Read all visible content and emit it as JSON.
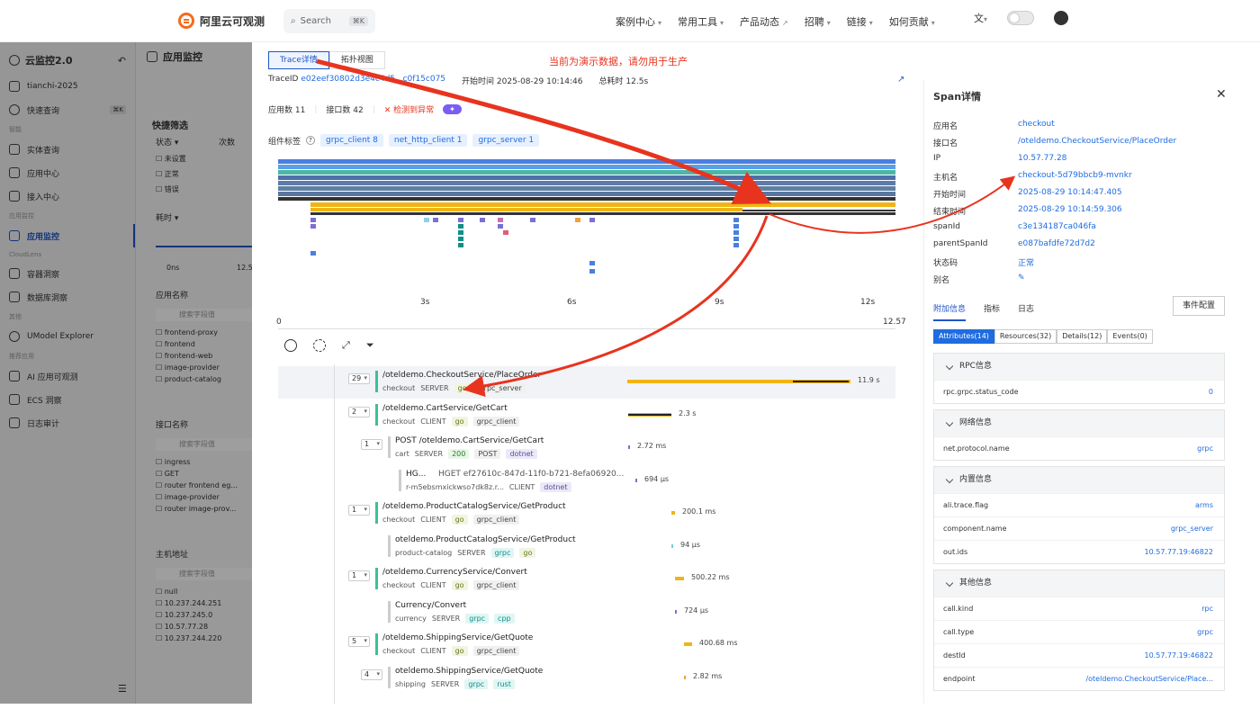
{
  "top": {
    "logo_text": "阿里云可观测",
    "search_placeholder": "Search",
    "search_kbd": "⌘K",
    "nav": [
      "案例中心",
      "常用工具",
      "产品动态",
      "招聘",
      "链接",
      "如何贡献"
    ]
  },
  "sidebar": {
    "title": "云监控2.0",
    "workspace": "tianchi-2025",
    "quick": "快速查询",
    "quick_kbd": "⌘K",
    "group1": "智能",
    "items1": [
      "实体查询",
      "应用中心",
      "接入中心"
    ],
    "group2": "应用监控",
    "active": "应用监控",
    "group3": "CloudLens",
    "items3": [
      "容器洞察",
      "数据库洞察"
    ],
    "group4": "其他",
    "items4": [
      "UModel Explorer"
    ],
    "group5": "推荐应用",
    "items5": [
      "AI 应用可观测",
      "ECS 洞察",
      "日志审计"
    ]
  },
  "filter": {
    "header": "应用监控",
    "quick_filter": "快捷筛选",
    "status": "状态",
    "count": "次数",
    "statuses": [
      "未设置",
      "正常",
      "错误"
    ],
    "elapsed": "耗时",
    "elapsed_min": "0ns",
    "elapsed_max": "12.5",
    "app_name": "应用名称",
    "search_field": "搜索字段值",
    "apps": [
      "frontend-proxy",
      "frontend",
      "frontend-web",
      "image-provider",
      "product-catalog"
    ],
    "iface": "接口名称",
    "ifaces": [
      "ingress",
      "GET",
      "router frontend eg...",
      "image-provider",
      "router image-prov..."
    ],
    "host": "主机地址",
    "hosts": [
      "null",
      "10.237.244.251",
      "10.237.245.0",
      "10.57.77.28",
      "10.237.244.220"
    ]
  },
  "trace": {
    "tab_detail": "Trace详情",
    "tab_topo": "拓扑视图",
    "warning": "当前为演示数据，请勿用于生产",
    "traceid_label": "TraceID",
    "traceid": "e02eef30802d3e4c4d5...c0f15c075",
    "start_label": "开始时间",
    "start": "2025-08-29 10:14:46",
    "total_label": "总耗时",
    "total": "12.5s",
    "apps_count": "应用数 11",
    "iface_count": "接口数 42",
    "anomaly": "检测到异常",
    "comp_label": "组件标签",
    "comp_tags": [
      "grpc_client 8",
      "net_http_client 1",
      "grpc_server 1"
    ],
    "axis": [
      "0",
      "3s",
      "6s",
      "9s",
      "12s",
      "12.57"
    ]
  },
  "spans": [
    {
      "count": "29",
      "name": "/oteldemo.CheckoutService/PlaceOrder",
      "svc": "checkout",
      "kind": "SERVER",
      "tags": [
        "go",
        "grpc_server"
      ],
      "dur": "11.9 s"
    },
    {
      "count": "2",
      "name": "/oteldemo.CartService/GetCart",
      "svc": "checkout",
      "kind": "CLIENT",
      "tags": [
        "go",
        "grpc_client"
      ],
      "dur": "2.3 s"
    },
    {
      "count": "1",
      "name": "POST /oteldemo.CartService/GetCart",
      "svc": "cart",
      "kind": "SERVER",
      "tags": [
        "200",
        "POST",
        "dotnet"
      ],
      "dur": "2.72 ms"
    },
    {
      "count": "",
      "name": "HG...",
      "extra": "HGET ef27610c-847d-11f0-b721-8efa06920...",
      "svc": "r-m5ebsmxickwso7dk8z.r...",
      "kind": "CLIENT",
      "tags": [
        "dotnet"
      ],
      "dur": "694 µs"
    },
    {
      "count": "1",
      "name": "/oteldemo.ProductCatalogService/GetProduct",
      "svc": "checkout",
      "kind": "CLIENT",
      "tags": [
        "go",
        "grpc_client"
      ],
      "dur": "200.1 ms"
    },
    {
      "count": "",
      "name": "oteldemo.ProductCatalogService/GetProduct",
      "svc": "product-catalog",
      "kind": "SERVER",
      "tags": [
        "grpc",
        "go"
      ],
      "dur": "94 µs"
    },
    {
      "count": "1",
      "name": "/oteldemo.CurrencyService/Convert",
      "svc": "checkout",
      "kind": "CLIENT",
      "tags": [
        "go",
        "grpc_client"
      ],
      "dur": "500.22 ms"
    },
    {
      "count": "",
      "name": "Currency/Convert",
      "svc": "currency",
      "kind": "SERVER",
      "tags": [
        "grpc",
        "cpp"
      ],
      "dur": "724 µs"
    },
    {
      "count": "5",
      "name": "/oteldemo.ShippingService/GetQuote",
      "svc": "checkout",
      "kind": "CLIENT",
      "tags": [
        "go",
        "grpc_client"
      ],
      "dur": "400.68 ms"
    },
    {
      "count": "4",
      "name": "oteldemo.ShippingService/GetQuote",
      "svc": "shipping",
      "kind": "SERVER",
      "tags": [
        "grpc",
        "rust"
      ],
      "dur": "2.82 ms"
    }
  ],
  "span_detail": {
    "title": "Span详情",
    "fields": [
      {
        "k": "应用名",
        "v": "checkout"
      },
      {
        "k": "接口名",
        "v": "/oteldemo.CheckoutService/PlaceOrder"
      },
      {
        "k": "IP",
        "v": "10.57.77.28"
      },
      {
        "k": "主机名",
        "v": "checkout-5d79bbcb9-mvnkr"
      },
      {
        "k": "开始时间",
        "v": "2025-08-29 10:14:47.405"
      },
      {
        "k": "结束时间",
        "v": "2025-08-29 10:14:59.306"
      },
      {
        "k": "spanId",
        "v": "c3e134187ca046fa"
      },
      {
        "k": "parentSpanId",
        "v": "e087bafdfe72d7d2"
      },
      {
        "k": "状态码",
        "v": "正常"
      },
      {
        "k": "别名",
        "v": "✎"
      }
    ],
    "tabs": [
      "附加信息",
      "指标",
      "日志"
    ],
    "event_btn": "事件配置",
    "attr_tabs": [
      "Attributes(14)",
      "Resources(32)",
      "Details(12)",
      "Events(0)"
    ],
    "cards": [
      {
        "title": "RPC信息",
        "rows": [
          {
            "k": "rpc.grpc.status_code",
            "v": "0"
          }
        ]
      },
      {
        "title": "网络信息",
        "rows": [
          {
            "k": "net.protocol.name",
            "v": "grpc"
          }
        ]
      },
      {
        "title": "内置信息",
        "rows": [
          {
            "k": "ali.trace.flag",
            "v": "arms"
          },
          {
            "k": "component.name",
            "v": "grpc_server"
          },
          {
            "k": "out.ids",
            "v": "10.57.77.19:46822"
          }
        ]
      },
      {
        "title": "其他信息",
        "rows": [
          {
            "k": "call.kind",
            "v": "rpc"
          },
          {
            "k": "call.type",
            "v": "grpc"
          },
          {
            "k": "destId",
            "v": "10.57.77.19:46822"
          },
          {
            "k": "endpoint",
            "v": "/oteldemo.CheckoutService/Place..."
          }
        ]
      }
    ]
  }
}
